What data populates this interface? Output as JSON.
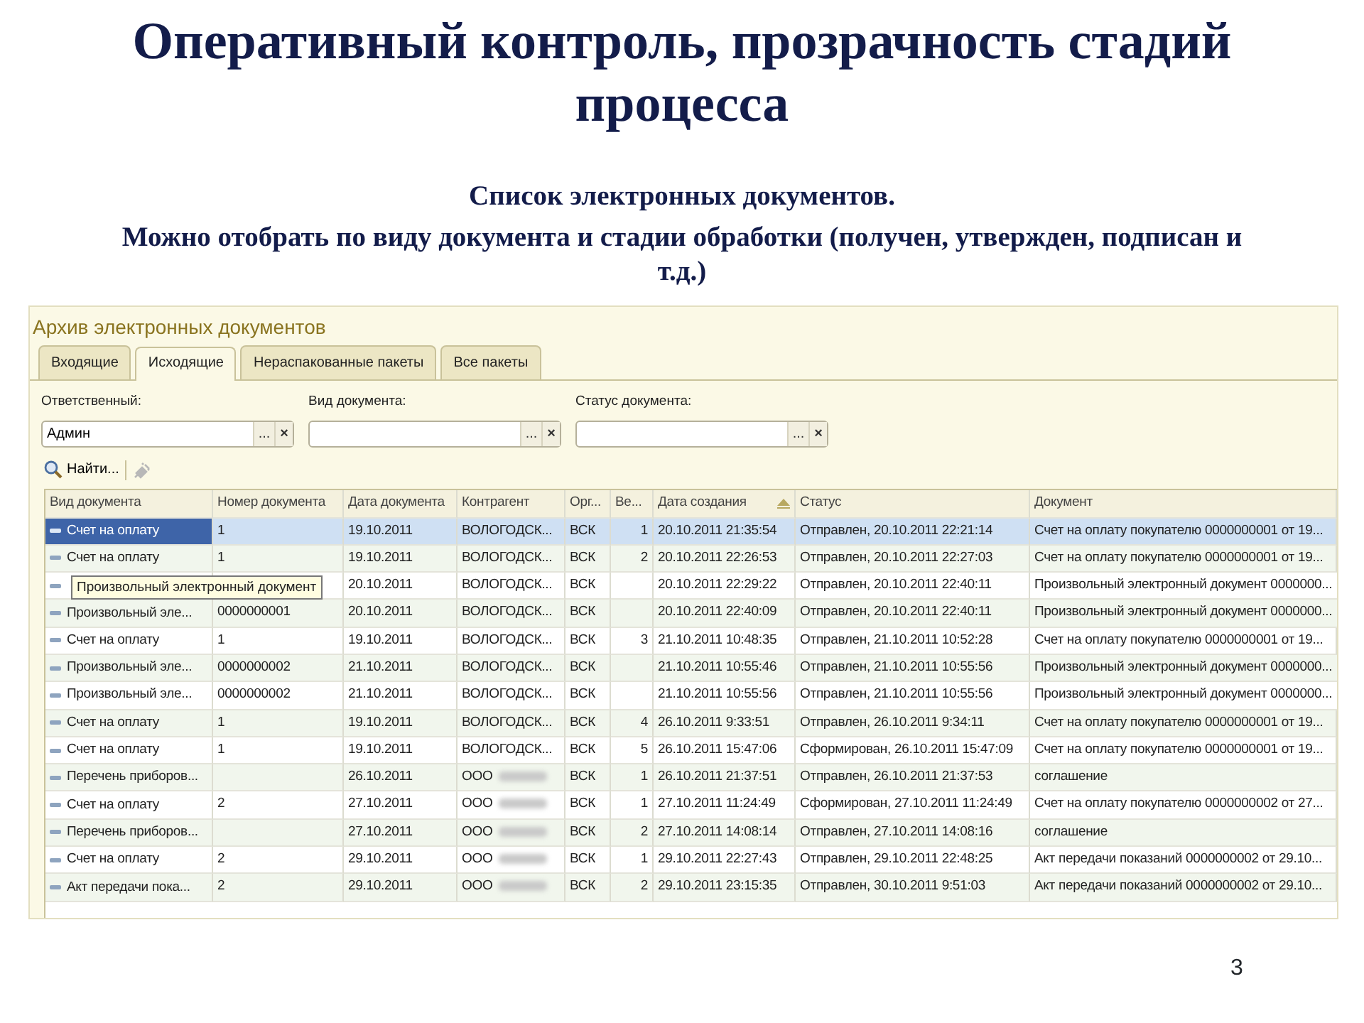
{
  "slide": {
    "title": "Оперативный контроль, прозрачность стадий процесса",
    "subtitle_lines": [
      "Список электронных документов.",
      "Можно отобрать по виду документа и стадии обработки (получен, утвержден, подписан и т.д.)"
    ],
    "page_number": "3"
  },
  "window": {
    "title": "Архив электронных документов",
    "tabs": [
      {
        "label": "Входящие",
        "selected": false
      },
      {
        "label": "Исходящие",
        "selected": true
      },
      {
        "label": "Нераспакованные пакеты",
        "selected": false
      },
      {
        "label": "Все пакеты",
        "selected": false
      }
    ],
    "filters": [
      {
        "label": "Ответственный:",
        "value": "Админ",
        "select_button": "...",
        "clear_button": "×"
      },
      {
        "label": "Вид документа:",
        "select_button": "...",
        "clear_button": "×"
      },
      {
        "label": "Статус документа:",
        "select_button": "...",
        "clear_button": "×"
      }
    ],
    "toolbar": [
      {
        "kind": "find",
        "label": "Найти...",
        "disabled": false
      },
      {
        "kind": "cancel",
        "disabled": true
      }
    ],
    "table": {
      "columns": [
        {
          "label": "Вид документа",
          "sorted": false
        },
        {
          "label": "Номер документа",
          "sorted": false
        },
        {
          "label": "Дата документа",
          "sorted": false
        },
        {
          "label": "Контрагент",
          "sorted": false
        },
        {
          "label": "Орг...",
          "sorted": false
        },
        {
          "label": "Ве...",
          "sorted": false
        },
        {
          "label": "Дата создания",
          "sorted": true
        },
        {
          "label": "Статус",
          "sorted": false
        },
        {
          "label": "Документ",
          "sorted": false
        }
      ],
      "rows": [
        {
          "selected": true,
          "cells": [
            "Счет на оплату",
            "1",
            "19.10.2011",
            "ВОЛОГОДСК...",
            "ВСК",
            "1",
            "20.10.2011 21:35:54",
            "Отправлен, 20.10.2011 22:21:14",
            "Счет на оплату покупателю 0000000001 от 19..."
          ]
        },
        {
          "selected": false,
          "cells": [
            "Счет на оплату",
            "1",
            "19.10.2011",
            "ВОЛОГОДСК...",
            "ВСК",
            "2",
            "20.10.2011 22:26:53",
            "Отправлен, 20.10.2011 22:27:03",
            "Счет на оплату покупателю 0000000001 от 19..."
          ]
        },
        {
          "selected": false,
          "tooltip": "Произвольный электронный документ",
          "cells": [
            null,
            null,
            "20.10.2011",
            "ВОЛОГОДСК...",
            "ВСК",
            null,
            "20.10.2011 22:29:22",
            "Отправлен, 20.10.2011 22:40:11",
            "Произвольный электронный документ 0000000..."
          ]
        },
        {
          "selected": false,
          "cells": [
            "Произвольный эле...",
            "0000000001",
            "20.10.2011",
            "ВОЛОГОДСК...",
            "ВСК",
            null,
            "20.10.2011 22:40:09",
            "Отправлен, 20.10.2011 22:40:11",
            "Произвольный электронный документ 0000000..."
          ]
        },
        {
          "selected": false,
          "cells": [
            "Счет на оплату",
            "1",
            "19.10.2011",
            "ВОЛОГОДСК...",
            "ВСК",
            "3",
            "21.10.2011 10:48:35",
            "Отправлен, 21.10.2011 10:52:28",
            "Счет на оплату покупателю 0000000001 от 19..."
          ]
        },
        {
          "selected": false,
          "cells": [
            "Произвольный эле...",
            "0000000002",
            "21.10.2011",
            "ВОЛОГОДСК...",
            "ВСК",
            null,
            "21.10.2011 10:55:46",
            "Отправлен, 21.10.2011 10:55:56",
            "Произвольный электронный документ 0000000..."
          ]
        },
        {
          "selected": false,
          "cells": [
            "Произвольный эле...",
            "0000000002",
            "21.10.2011",
            "ВОЛОГОДСК...",
            "ВСК",
            null,
            "21.10.2011 10:55:56",
            "Отправлен, 21.10.2011 10:55:56",
            "Произвольный электронный документ 0000000..."
          ]
        },
        {
          "selected": false,
          "cells": [
            "Счет на оплату",
            "1",
            "19.10.2011",
            "ВОЛОГОДСК...",
            "ВСК",
            "4",
            "26.10.2011 9:33:51",
            "Отправлен, 26.10.2011 9:34:11",
            "Счет на оплату покупателю 0000000001 от 19..."
          ]
        },
        {
          "selected": false,
          "cells": [
            "Счет на оплату",
            "1",
            "19.10.2011",
            "ВОЛОГОДСК...",
            "ВСК",
            "5",
            "26.10.2011 15:47:06",
            "Сформирован, 26.10.2011 15:47:09",
            "Счет на оплату покупателю 0000000001 от 19..."
          ]
        },
        {
          "selected": false,
          "redacted": true,
          "cells": [
            "Перечень приборов...",
            null,
            "26.10.2011",
            "ООО",
            "ВСК",
            "1",
            "26.10.2011 21:37:51",
            "Отправлен, 26.10.2011 21:37:53",
            "соглашение"
          ]
        },
        {
          "selected": false,
          "redacted": true,
          "cells": [
            "Счет на оплату",
            "2",
            "27.10.2011",
            "ООО",
            "ВСК",
            "1",
            "27.10.2011 11:24:49",
            "Сформирован, 27.10.2011 11:24:49",
            "Счет на оплату покупателю 0000000002 от 27..."
          ]
        },
        {
          "selected": false,
          "redacted": true,
          "cells": [
            "Перечень приборов...",
            null,
            "27.10.2011",
            "ООО",
            "ВСК",
            "2",
            "27.10.2011 14:08:14",
            "Отправлен, 27.10.2011 14:08:16",
            "соглашение"
          ]
        },
        {
          "selected": false,
          "redacted": true,
          "cells": [
            "Счет на оплату",
            "2",
            "29.10.2011",
            "ООО",
            "ВСК",
            "1",
            "29.10.2011 22:27:43",
            "Отправлен, 29.10.2011 22:48:25",
            "Акт передачи показаний 0000000002 от 29.10..."
          ]
        },
        {
          "selected": false,
          "redacted": true,
          "cells": [
            "Акт передачи пока...",
            "2",
            "29.10.2011",
            "ООО",
            "ВСК",
            "2",
            "29.10.2011 23:15:35",
            "Отправлен, 30.10.2011 9:51:03",
            "Акт передачи показаний 0000000002 от 29.10..."
          ]
        }
      ]
    }
  }
}
